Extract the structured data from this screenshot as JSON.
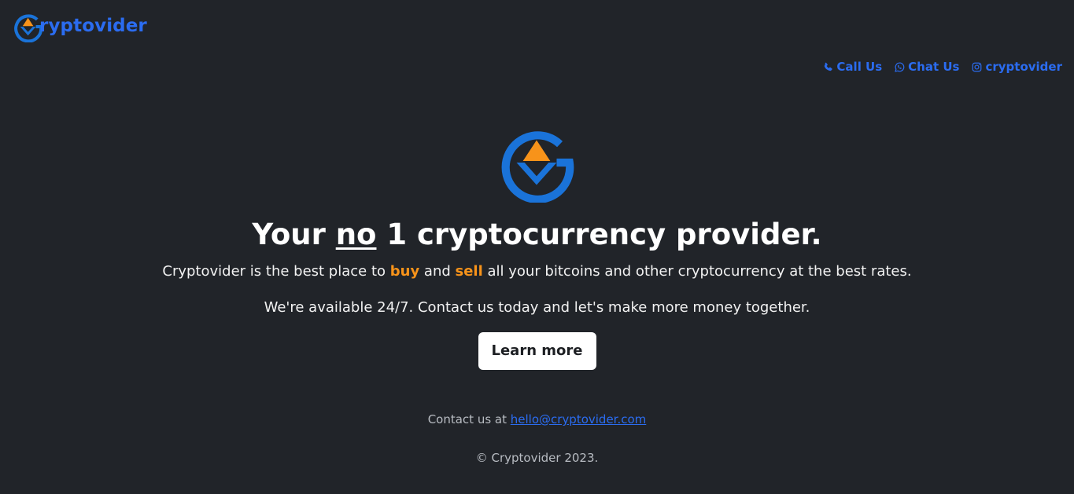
{
  "brand": {
    "name": "Gryptovider",
    "text_after_logo": "ryptovider",
    "logo_icon": "g-arrow-logo-icon"
  },
  "nav": {
    "call": {
      "icon": "phone-icon",
      "label": "Call Us"
    },
    "chat": {
      "icon": "whatsapp-icon",
      "label": "Chat Us"
    },
    "instagram": {
      "icon": "instagram-icon",
      "label": "cryptovider"
    }
  },
  "hero": {
    "logo_icon": "g-arrow-logo-icon",
    "title_before": "Your ",
    "title_underlined": "no",
    "title_after": " 1 cryptocurrency provider.",
    "desc_before": "Cryptovider is the best place to ",
    "desc_buy": "buy",
    "desc_middle": " and ",
    "desc_sell": "sell",
    "desc_after": " all your bitcoins and other cryptocurrency at the best rates.",
    "availability": "We're available 24/7. Contact us today and let's make more money together.",
    "button_label": "Learn more"
  },
  "footer": {
    "contact_prefix": "Contact us at ",
    "email": "hello@cryptovider.com",
    "copyright": "© Cryptovider 2023."
  },
  "colors": {
    "background": "#212429",
    "brand_blue": "#2b6cf0",
    "logo_blue": "#1a73d9",
    "accent_orange": "#f7931a",
    "text": "#ffffff",
    "muted": "#b8bcc2"
  }
}
